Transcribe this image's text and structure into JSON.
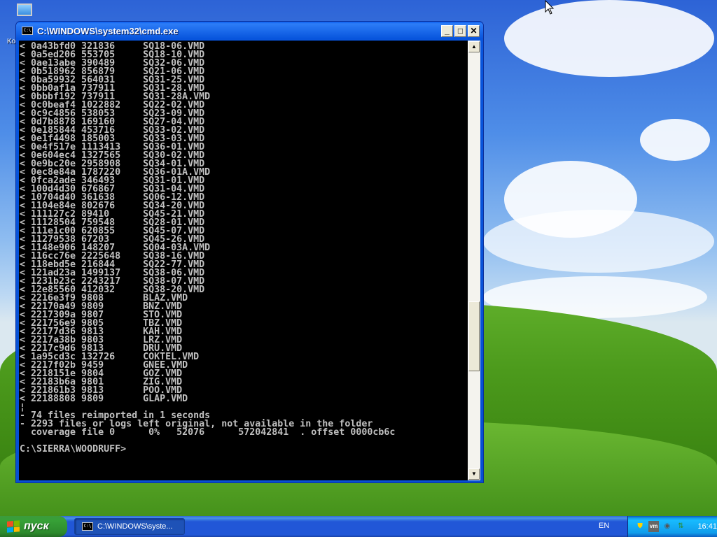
{
  "desktop": {
    "icon_label": "Ko"
  },
  "window": {
    "title": "C:\\WINDOWS\\system32\\cmd.exe",
    "minimize": "_",
    "maximize": "□",
    "close": "✕"
  },
  "console": {
    "lines": [
      "< 0a43bfd0 321836     SQ18-06.VMD",
      "< 0a5ed206 553705     SQ18-10.VMD",
      "< 0ae13abe 390489     SQ32-06.VMD",
      "< 0b518962 856879     SQ21-06.VMD",
      "< 0ba59932 564031     SQ31-25.VMD",
      "< 0bb0af1a 737911     SQ31-28.VMD",
      "< 0bbbf192 737911     SQ31-28A.VMD",
      "< 0c0beaf4 1022882    SQ22-02.VMD",
      "< 0c9c4856 538053     SQ23-09.VMD",
      "< 0d7b8878 169160     SQ27-04.VMD",
      "< 0e185844 453716     SQ33-02.VMD",
      "< 0e1f4498 185003     SQ33-03.VMD",
      "< 0e4f517e 1113413    SQ36-01.VMD",
      "< 0e604ec4 1327565    SQ30-02.VMD",
      "< 0e9bc20e 2958908    SQ34-01.VMD",
      "< 0ec8e84a 1787220    SQ36-01A.VMD",
      "< 0fca2ade 346493     SQ31-01.VMD",
      "< 100d4d30 676867     SQ31-04.VMD",
      "< 10704d40 361638     SQ06-12.VMD",
      "< 1104e84e 802676     SQ34-20.VMD",
      "< 111127c2 89410      SQ45-21.VMD",
      "< 11128504 759548     SQ28-01.VMD",
      "< 111e1c00 620855     SQ45-07.VMD",
      "< 11279538 67203      SQ45-26.VMD",
      "< 1148e906 148207     SQ04-03A.VMD",
      "< 116cc76e 2225648    SQ38-16.VMD",
      "< 118ebd5e 216844     SQ22-77.VMD",
      "< 121ad23a 1499137    SQ38-06.VMD",
      "< 1231b23c 2243217    SQ38-07.VMD",
      "< 12e85560 412032     SQ38-20.VMD",
      "< 2216e3f9 9808       BLAZ.VMD",
      "< 22170a49 9809       BNZ.VMD",
      "< 2217309a 9807       STO.VMD",
      "< 221756e9 9805       TBZ.VMD",
      "< 22177d36 9813       KAH.VMD",
      "< 2217a38b 9803       LRZ.VMD",
      "< 2217c9d6 9813       DRU.VMD",
      "< 1a95cd3c 132726     COKTEL.VMD",
      "< 2217f02b 9459       GNEE.VMD",
      "< 2218151e 9804       GOZ.VMD",
      "< 22183b6a 9801       ZIG.VMD",
      "< 221861b3 9813       POO.VMD",
      "< 22188808 9809       GLAP.VMD",
      "¦",
      "- 74 files reimported in 1 seconds",
      "- 2293 files or logs left original, not available in the folder",
      "  coverage file 0      0%   52076      572042841  . offset 0000cb6c",
      "",
      "C:\\SIERRA\\WOODRUFF>"
    ]
  },
  "scrollbar": {
    "up": "▲",
    "down": "▼"
  },
  "taskbar": {
    "start_label": "пуск",
    "task_label": "C:\\WINDOWS\\syste...",
    "task_icon_text": "C:\\",
    "language": "EN",
    "clock": "16:41",
    "tray_icons": [
      "security-shield-icon",
      "vmware-icon",
      "volume-icon",
      "network-icon"
    ]
  },
  "colors": {
    "console_bg": "#000000",
    "console_text": "#c0c0c0",
    "titlebar": "#0855dd",
    "taskbar": "#2157d7",
    "start": "#37a137"
  }
}
